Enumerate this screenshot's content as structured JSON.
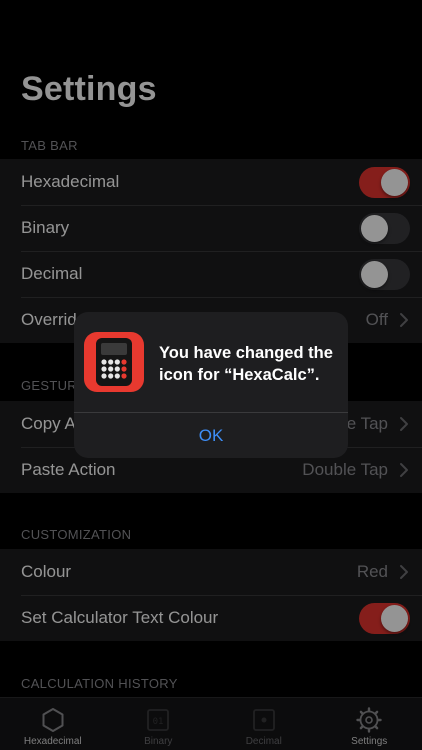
{
  "page": {
    "title": "Settings"
  },
  "sections": {
    "tab_bar": {
      "header": "TAB BAR",
      "rows": [
        {
          "label": "Hexadecimal",
          "toggle": "on"
        },
        {
          "label": "Binary",
          "toggle": "off"
        },
        {
          "label": "Decimal",
          "toggle": "off"
        },
        {
          "label": "Overrid",
          "value": "Off"
        }
      ]
    },
    "gestures": {
      "header": "GESTUR",
      "rows": [
        {
          "label": "Copy A",
          "value": "e Tap"
        },
        {
          "label": "Paste Action",
          "value": "Double Tap"
        }
      ]
    },
    "customization": {
      "header": "CUSTOMIZATION",
      "rows": [
        {
          "label": "Colour",
          "value": "Red"
        },
        {
          "label": "Set Calculator Text Colour",
          "toggle": "on"
        }
      ]
    },
    "calculation_history": {
      "header": "CALCULATION HISTORY"
    }
  },
  "alert": {
    "message": "You have changed the icon for “HexaCalc”.",
    "button": "OK",
    "icon": "calculator-app-icon"
  },
  "tabbar": {
    "items": [
      {
        "label": "Hexadecimal",
        "icon": "hexagon-icon",
        "active": true
      },
      {
        "label": "Binary",
        "icon": "binary-icon",
        "active": false
      },
      {
        "label": "Decimal",
        "icon": "decimal-icon",
        "active": false
      },
      {
        "label": "Settings",
        "icon": "gear-icon",
        "active": true
      }
    ]
  },
  "colors": {
    "accent_red": "#e5342f",
    "link_blue": "#3e8ef7",
    "group_bg": "#1c1c1e",
    "secondary_text": "#8e8e93"
  }
}
